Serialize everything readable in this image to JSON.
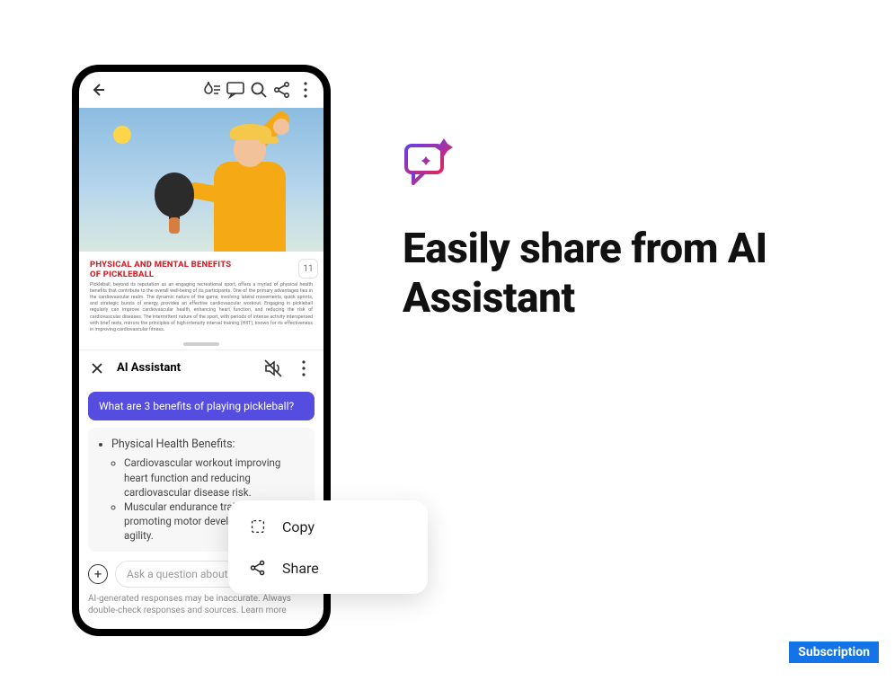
{
  "toolbar": {
    "back": "back",
    "liquid": "liquid-mode",
    "comment": "comment",
    "search": "search",
    "share": "share",
    "overflow": "more"
  },
  "document": {
    "title_line1": "PHYSICAL AND MENTAL BENEFITS",
    "title_line2": "OF PICKLEBALL",
    "body": "Pickleball, beyond its reputation as an engaging recreational sport, offers a myriad of physical health benefits that contribute to the overall well-being of its participants. One of the primary advantages lies in the cardiovascular realm. The dynamic nature of the game, involving lateral movements, quick sprints, and strategic bursts of energy, provides an effective cardiovascular workout. Engaging in pickleball regularly can improve cardiovascular health, enhancing heart function, and reducing the risk of cardiovascular diseases. The intermittent nature of the sport, with periods of intense activity interspersed with brief rests, mirrors the principles of high-intensity interval training (HIIT), known for its effectiveness in improving cardiovascular fitness.",
    "page": "11"
  },
  "assistant": {
    "title": "AI Assistant",
    "question": "What are 3 benefits of playing pickleball?",
    "answer": {
      "heading": "Physical Health Benefits:",
      "bullets": [
        "Cardiovascular workout improving heart function and reducing cardiovascular disease risk.",
        "Muscular endurance training promoting motor development, and agility."
      ]
    },
    "input_placeholder": "Ask a question about this document",
    "disclaimer": "AI-generated responses may be inaccurate. Always double-check responses and sources. Learn more"
  },
  "popover": {
    "copy": "Copy",
    "share": "Share"
  },
  "marketing": {
    "headline": "Easily share from AI Assistant",
    "badge": "Subscription"
  }
}
